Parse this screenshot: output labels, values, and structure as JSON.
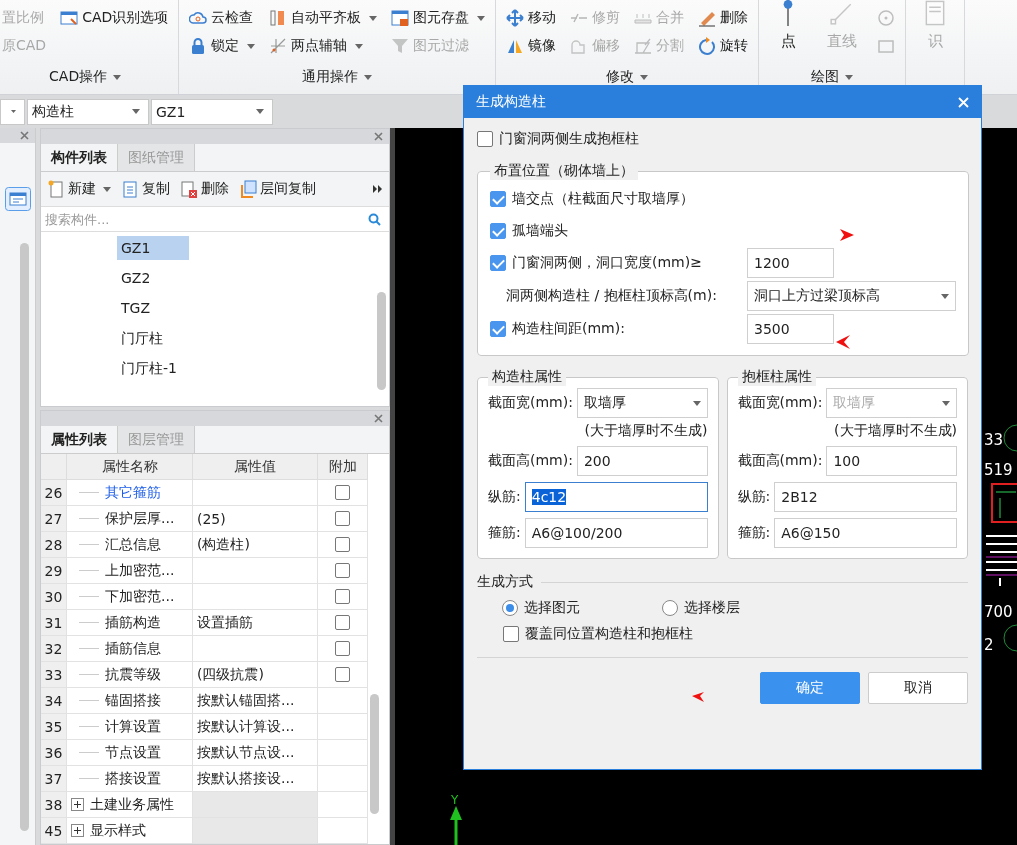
{
  "ribbon": {
    "groups": [
      {
        "label": "CAD操作",
        "columns": [
          [
            {
              "label": "置比例",
              "kind": "small",
              "disabled": true,
              "dropdown": false
            },
            {
              "label": "原CAD",
              "kind": "small",
              "disabled": true,
              "dropdown": false
            }
          ],
          [
            {
              "label": "CAD识别选项",
              "kind": "small",
              "disabled": false,
              "dropdown": false
            }
          ]
        ]
      },
      {
        "label": "通用操作",
        "columns": [
          [
            {
              "label": "云检查",
              "kind": "small",
              "disabled": false,
              "dropdown": false
            },
            {
              "label": "锁定",
              "kind": "small",
              "disabled": false,
              "dropdown": true
            }
          ],
          [
            {
              "label": "自动平齐板",
              "kind": "small",
              "disabled": false,
              "dropdown": true
            },
            {
              "label": "两点辅轴",
              "kind": "small",
              "disabled": false,
              "dropdown": true
            }
          ],
          [
            {
              "label": "图元存盘",
              "kind": "small",
              "disabled": false,
              "dropdown": true
            },
            {
              "label": "图元过滤",
              "kind": "small",
              "disabled": true,
              "dropdown": false
            }
          ]
        ]
      },
      {
        "label": "修改",
        "columns": [
          [
            {
              "label": "移动",
              "kind": "small",
              "disabled": false,
              "dropdown": false
            },
            {
              "label": "镜像",
              "kind": "small",
              "disabled": false,
              "dropdown": false
            }
          ],
          [
            {
              "label": "修剪",
              "kind": "small",
              "disabled": true,
              "dropdown": false
            },
            {
              "label": "偏移",
              "kind": "small",
              "disabled": true,
              "dropdown": false
            }
          ],
          [
            {
              "label": "合并",
              "kind": "small",
              "disabled": true,
              "dropdown": false
            },
            {
              "label": "分割",
              "kind": "small",
              "disabled": true,
              "dropdown": false
            }
          ],
          [
            {
              "label": "删除",
              "kind": "small",
              "disabled": false,
              "dropdown": false
            },
            {
              "label": "旋转",
              "kind": "small",
              "disabled": false,
              "dropdown": false
            }
          ]
        ]
      },
      {
        "label": "绘图",
        "columns": [
          [
            {
              "label": "点",
              "kind": "large",
              "disabled": false
            }
          ],
          [
            {
              "label": "直线",
              "kind": "large",
              "disabled": true
            }
          ],
          [
            {
              "kind": "icon",
              "disabled": true
            },
            {
              "kind": "icon",
              "disabled": true
            }
          ]
        ]
      },
      {
        "columns": [
          [
            {
              "label": "识",
              "kind": "large",
              "disabled": true
            }
          ]
        ]
      }
    ]
  },
  "selectors": [
    {
      "value": "构造柱"
    },
    {
      "value": "GZ1"
    }
  ],
  "component_panel": {
    "tabs": [
      {
        "label": "构件列表",
        "selected": true
      },
      {
        "label": "图纸管理",
        "selected": false
      }
    ],
    "toolbar": [
      {
        "label": "新建",
        "dropdown": true
      },
      {
        "label": "复制",
        "dropdown": false
      },
      {
        "label": "删除",
        "dropdown": false
      },
      {
        "label": "层间复制",
        "dropdown": false
      }
    ],
    "search": {
      "placeholder": "搜索构件..."
    },
    "items": [
      {
        "label": "GZ1",
        "selected": true
      },
      {
        "label": "GZ2",
        "selected": false
      },
      {
        "label": "TGZ",
        "selected": false
      },
      {
        "label": "门厅柱",
        "selected": false
      },
      {
        "label": "门厅柱-1",
        "selected": false
      }
    ]
  },
  "property_panel": {
    "tabs": [
      {
        "label": "属性列表",
        "selected": true
      },
      {
        "label": "图层管理",
        "selected": false
      }
    ],
    "columns": [
      "属性名称",
      "属性值",
      "附加"
    ],
    "rows": [
      {
        "index": "26",
        "kind": "check",
        "name": "其它箍筋",
        "highlighted": true,
        "checked": false
      },
      {
        "index": "27",
        "kind": "check",
        "name": "保护层厚...",
        "value": "(25)",
        "highlighted": false,
        "checked": false
      },
      {
        "index": "28",
        "kind": "check",
        "name": "汇总信息",
        "value": "(构造柱)",
        "highlighted": false,
        "checked": false
      },
      {
        "index": "29",
        "kind": "check",
        "name": "上加密范...",
        "highlighted": false,
        "checked": false
      },
      {
        "index": "30",
        "kind": "check",
        "name": "下加密范...",
        "highlighted": false,
        "checked": false
      },
      {
        "index": "31",
        "kind": "check",
        "name": "插筋构造",
        "value": "设置插筋",
        "highlighted": false,
        "checked": false
      },
      {
        "index": "32",
        "kind": "check",
        "name": "插筋信息",
        "highlighted": false,
        "checked": false
      },
      {
        "index": "33",
        "kind": "check",
        "name": "抗震等级",
        "value": "(四级抗震)",
        "highlighted": false,
        "checked": false
      },
      {
        "index": "34",
        "kind": "plain",
        "name": "锚固搭接",
        "value": "按默认锚固搭...",
        "highlighted": false
      },
      {
        "index": "35",
        "kind": "plain",
        "name": "计算设置",
        "value": "按默认计算设...",
        "highlighted": false
      },
      {
        "index": "36",
        "kind": "plain",
        "name": "节点设置",
        "value": "按默认节点设...",
        "highlighted": false
      },
      {
        "index": "37",
        "kind": "plain",
        "name": "搭接设置",
        "value": "按默认搭接设...",
        "highlighted": false
      },
      {
        "index": "38",
        "kind": "group",
        "name": "土建业务属性",
        "highlighted": false
      },
      {
        "index": "45",
        "kind": "group",
        "name": "显示样式",
        "highlighted": false
      }
    ]
  },
  "dialog": {
    "title": "生成构造柱",
    "top_option": {
      "label": "门窗洞两侧生成抱框柱",
      "checked": false
    },
    "placement": {
      "title": "布置位置（砌体墙上）",
      "rows": [
        {
          "kind": "check",
          "label": "墙交点（柱截面尺寸取墙厚）",
          "checked": true
        },
        {
          "kind": "check",
          "label": "孤墙端头",
          "checked": true
        },
        {
          "kind": "check-input",
          "label": "门窗洞两侧，洞口宽度(mm)≥",
          "checked": true,
          "value": "1200"
        },
        {
          "kind": "select",
          "label": "洞两侧构造柱 / 抱框柱顶标高(m):",
          "value": "洞口上方过梁顶标高"
        },
        {
          "kind": "check-input",
          "label": "构造柱间距(mm):",
          "checked": true,
          "value": "3500"
        }
      ]
    },
    "column_groups": [
      {
        "title": "构造柱属性",
        "width": {
          "label": "截面宽(mm):",
          "value": "取墙厚",
          "disabled": false
        },
        "note": "(大于墙厚时不生成)",
        "height": {
          "label": "截面高(mm):",
          "value": "200"
        },
        "main_bar": {
          "label": "纵筋:",
          "value": "4c12",
          "focused": true
        },
        "stirrup": {
          "label": "箍筋:",
          "value": "A6@100/200"
        }
      },
      {
        "title": "抱框柱属性",
        "width": {
          "label": "截面宽(mm):",
          "value": "取墙厚",
          "disabled": true
        },
        "note": "(大于墙厚时不生成)",
        "height": {
          "label": "截面高(mm):",
          "value": "100"
        },
        "main_bar": {
          "label": "纵筋:",
          "value": "2B12",
          "focused": false
        },
        "stirrup": {
          "label": "箍筋:",
          "value": "A6@150"
        }
      }
    ],
    "mode": {
      "title": "生成方式",
      "options": [
        {
          "label": "选择图元",
          "selected": true
        },
        {
          "label": "选择楼层",
          "selected": false
        }
      ],
      "overwrite": {
        "label": "覆盖同位置构造柱和抱框柱",
        "checked": false
      }
    },
    "buttons": [
      {
        "label": "确定",
        "kind": "primary"
      },
      {
        "label": "取消",
        "kind": "secondary"
      }
    ]
  },
  "canvas": {
    "axis_labels": [
      "33",
      "519",
      "700",
      "2"
    ],
    "axis_name": "Y"
  }
}
